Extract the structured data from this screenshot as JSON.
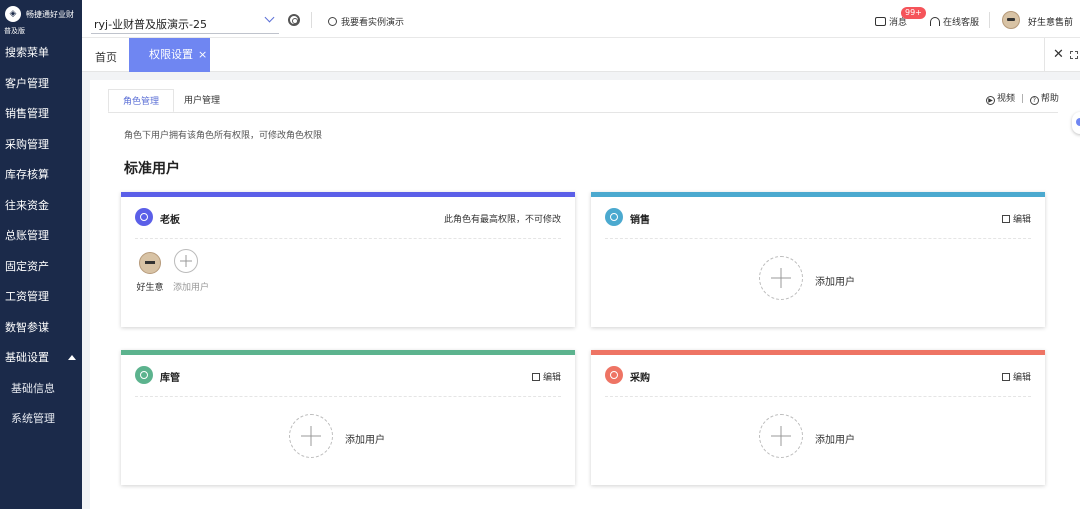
{
  "brand": {
    "name": "畅捷通好业财",
    "edition": "普及版"
  },
  "sidebar": {
    "items": [
      {
        "label": "搜索菜单"
      },
      {
        "label": "客户管理"
      },
      {
        "label": "销售管理"
      },
      {
        "label": "采购管理"
      },
      {
        "label": "库存核算"
      },
      {
        "label": "往来资金"
      },
      {
        "label": "总账管理"
      },
      {
        "label": "固定资产"
      },
      {
        "label": "工资管理"
      },
      {
        "label": "数智参谋"
      },
      {
        "label": "基础设置"
      }
    ],
    "subitems": [
      {
        "label": "基础信息"
      },
      {
        "label": "系统管理"
      }
    ]
  },
  "topbar": {
    "account": "ryj-业财普及版演示-25",
    "demo_link": "我要看实例演示",
    "messages_label": "消息",
    "messages_badge": "99+",
    "support_label": "在线客服",
    "username": "好生意售前"
  },
  "tabs": {
    "home": "首页",
    "active": "权限设置",
    "close": "×"
  },
  "main": {
    "subtabs": [
      "角色管理",
      "用户管理"
    ],
    "video_label": "视频",
    "help_label": "帮助",
    "notice": "角色下用户拥有该角色所有权限，可修改角色权限",
    "section_title": "标准用户",
    "edit_label": "编辑",
    "add_user_label": "添加用户",
    "roles": [
      {
        "name": "老板",
        "note": "此角色有最高权限，不可修改",
        "color": "#5b5fe8",
        "users": [
          {
            "name": "好生意"
          }
        ]
      },
      {
        "name": "销售",
        "color": "#4ba9cf",
        "users": []
      },
      {
        "name": "库管",
        "color": "#5cb38e",
        "users": []
      },
      {
        "name": "采购",
        "color": "#ee7464",
        "users": []
      }
    ]
  }
}
